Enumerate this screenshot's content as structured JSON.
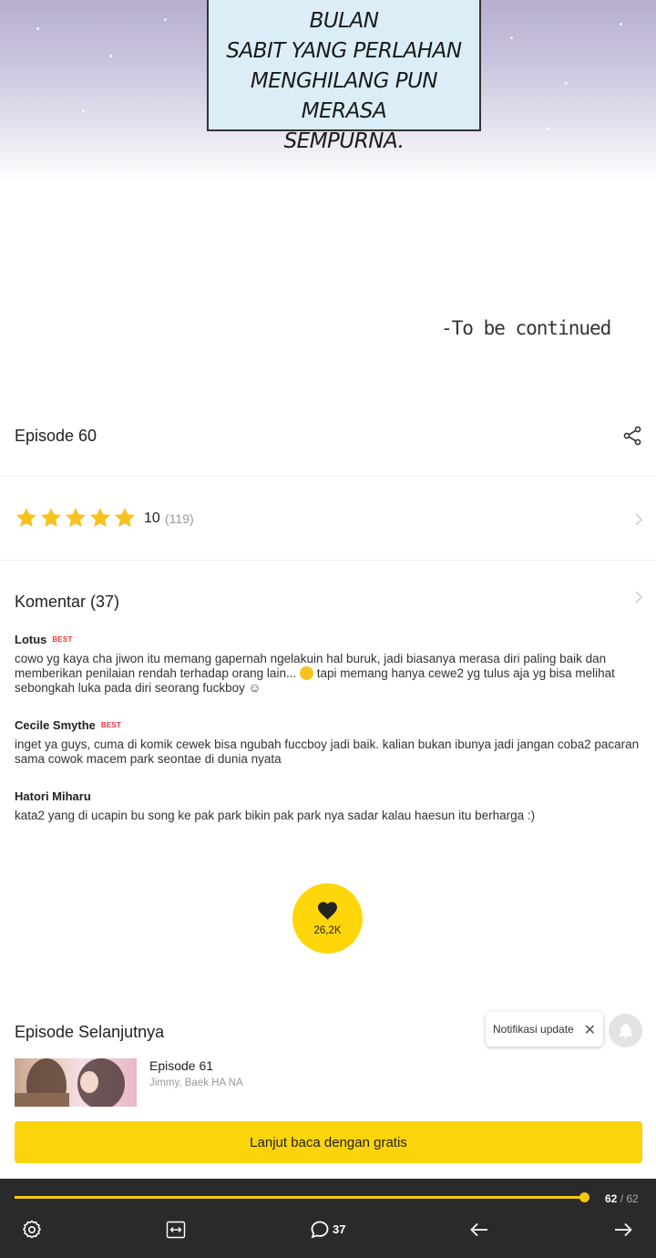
{
  "panel": {
    "caption": "BERADA DI BAWAH BULAN\nSABIT YANG PERLAHAN\nMENGHILANG PUN MERASA\nSEMPURNA.",
    "to_be_continued": "-To be continued"
  },
  "episode": {
    "title": "Episode 60",
    "rating_value": "10",
    "rating_count": "(119)",
    "stars_filled": 5
  },
  "comments": {
    "title": "Komentar (37)",
    "best_label": "BEST",
    "items": [
      {
        "author": "Lotus",
        "best": true,
        "text_before_emoji": "cowo yg kaya cha jiwon itu memang gapernah ngelakuin hal buruk, jadi biasanya merasa diri paling baik dan memberikan penilaian rendah terhadap orang lain... ",
        "text_after_emoji": " tapi memang hanya cewe2 yg tulus aja yg bisa melihat sebongkah luka pada diri seorang fuckboy ☺"
      },
      {
        "author": "Cecile Smythe",
        "best": true,
        "text": "inget ya guys, cuma di komik cewek bisa ngubah fuccboy jadi baik. kalian bukan ibunya jadi jangan coba2 pacaran sama cowok macem park seontae di dunia nyata"
      },
      {
        "author": "Hatori Miharu",
        "best": false,
        "text": "kata2 yang di ucapin bu song ke pak park bikin pak park nya sadar kalau haesun itu berharga :)"
      }
    ]
  },
  "like": {
    "count": "26,2K"
  },
  "next_episode": {
    "section_title": "Episode Selanjutnya",
    "episode": "Episode 61",
    "authors": "Jimmy, Baek HA NA",
    "cta_label": "Lanjut baca dengan gratis",
    "notif_label": "Notifikasi update",
    "notif_close": "✕"
  },
  "toolbar": {
    "progress_fraction": 1.0,
    "current_page": "62",
    "total_page": "/ 62",
    "comment_count": "37"
  },
  "colors": {
    "accent_yellow": "#fcd40c",
    "star_yellow": "#f7c21e",
    "best_red": "#e8333a",
    "toolbar_bg": "#2a2a2a"
  },
  "icons": [
    "share-icon",
    "star-icon",
    "chevron-right-icon",
    "heart-icon",
    "bell-icon",
    "close-icon",
    "settings-icon",
    "fit-width-icon",
    "comment-icon",
    "arrow-left-icon",
    "arrow-right-icon"
  ]
}
